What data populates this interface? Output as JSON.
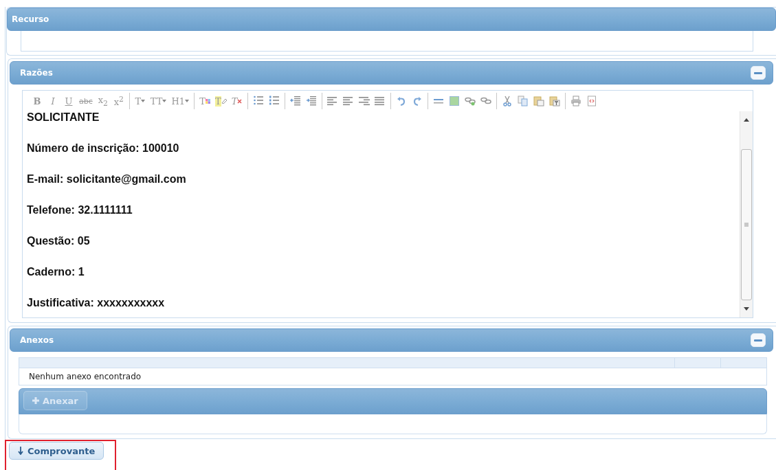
{
  "panels": [
    {
      "kind": "plain",
      "title": "Recurso",
      "collapsible": false
    },
    {
      "kind": "editor",
      "title": "Razões",
      "collapsible": true,
      "toolbar": [
        [
          {
            "kind": "bold",
            "label": "B"
          },
          {
            "kind": "italic",
            "label": "I"
          },
          {
            "kind": "underline",
            "label": "U"
          },
          {
            "kind": "strike",
            "label": "abc"
          },
          {
            "kind": "script",
            "label": "x$_{2}$"
          },
          {
            "kind": "script",
            "label": "x$^{2}$"
          }
        ],
        [
          {
            "kind": "dropdown",
            "label": "T"
          },
          {
            "kind": "dropdown",
            "label": "TT"
          },
          {
            "kind": "dropdown",
            "label": "H1"
          }
        ],
        [
          {
            "kind": "color",
            "label": "T"
          },
          {
            "kind": "highlight",
            "label": "T"
          },
          {
            "kind": "clear",
            "label": "T"
          }
        ],
        [
          {
            "kind": "bullets"
          },
          {
            "kind": "numbers"
          }
        ],
        [
          {
            "kind": "outdent"
          },
          {
            "kind": "indent"
          }
        ],
        [
          {
            "kind": "align-left"
          },
          {
            "kind": "align-center"
          },
          {
            "kind": "align-right"
          },
          {
            "kind": "justify"
          }
        ],
        [
          {
            "kind": "undo"
          },
          {
            "kind": "redo"
          }
        ],
        [
          {
            "kind": "rule"
          },
          {
            "kind": "image"
          },
          {
            "kind": "link"
          },
          {
            "kind": "unlink"
          }
        ],
        [
          {
            "kind": "cut"
          },
          {
            "kind": "copy"
          },
          {
            "kind": "paste"
          },
          {
            "kind": "paste-text"
          }
        ],
        [
          {
            "kind": "print"
          },
          {
            "kind": "source"
          }
        ]
      ],
      "content": [
        "SOLICITANTE",
        "Número de inscrição: 100010",
        "E-mail: solicitante@gmail.com",
        "Telefone: 32.1111111",
        "Questão: 05",
        "Caderno: 1",
        "Justificativa: xxxxxxxxxxx"
      ]
    },
    {
      "kind": "attachments",
      "title": "Anexos",
      "collapsible": true,
      "empty_message": "Nenhum anexo encontrado",
      "add_button": {
        "label": "Anexar",
        "disabled": true
      }
    }
  ],
  "download_button": {
    "label": "Comprovante",
    "highlighted": true
  }
}
